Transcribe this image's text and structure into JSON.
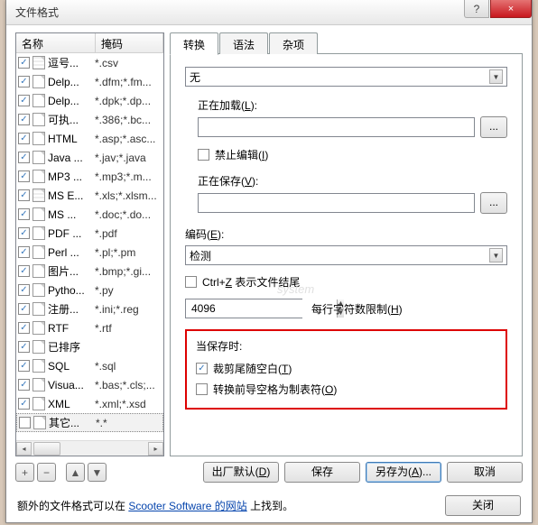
{
  "window": {
    "title": "文件格式",
    "help": "?",
    "close": "×"
  },
  "left": {
    "col_name": "名称",
    "col_mask": "掩码",
    "items": [
      {
        "chk": true,
        "icon": "grid",
        "name": "逗号...",
        "mask": "*.csv"
      },
      {
        "chk": true,
        "icon": "page",
        "name": "Delp...",
        "mask": "*.dfm;*.fm..."
      },
      {
        "chk": true,
        "icon": "page",
        "name": "Delp...",
        "mask": "*.dpk;*.dp..."
      },
      {
        "chk": true,
        "icon": "gear",
        "name": "可执...",
        "mask": "*.386;*.bc..."
      },
      {
        "chk": true,
        "icon": "page",
        "name": "HTML",
        "mask": "*.asp;*.asc..."
      },
      {
        "chk": true,
        "icon": "page",
        "name": "Java ...",
        "mask": "*.jav;*.java"
      },
      {
        "chk": true,
        "icon": "music",
        "name": "MP3 ...",
        "mask": "*.mp3;*.m..."
      },
      {
        "chk": true,
        "icon": "grid",
        "name": "MS E...",
        "mask": "*.xls;*.xlsm..."
      },
      {
        "chk": true,
        "icon": "page",
        "name": "MS ...",
        "mask": "*.doc;*.do..."
      },
      {
        "chk": true,
        "icon": "page",
        "name": "PDF ...",
        "mask": "*.pdf"
      },
      {
        "chk": true,
        "icon": "page",
        "name": "Perl ...",
        "mask": "*.pl;*.pm"
      },
      {
        "chk": true,
        "icon": "page",
        "name": "图片...",
        "mask": "*.bmp;*.gi..."
      },
      {
        "chk": true,
        "icon": "page",
        "name": "Pytho...",
        "mask": "*.py"
      },
      {
        "chk": true,
        "icon": "page",
        "name": "注册...",
        "mask": "*.ini;*.reg"
      },
      {
        "chk": true,
        "icon": "page",
        "name": "RTF",
        "mask": "*.rtf"
      },
      {
        "chk": true,
        "icon": "page",
        "name": "已排序",
        "mask": ""
      },
      {
        "chk": true,
        "icon": "page",
        "name": "SQL",
        "mask": "*.sql"
      },
      {
        "chk": true,
        "icon": "page",
        "name": "Visua...",
        "mask": "*.bas;*.cls;..."
      },
      {
        "chk": true,
        "icon": "page",
        "name": "XML",
        "mask": "*.xml;*.xsd"
      },
      {
        "chk": false,
        "icon": "page",
        "name": "其它...",
        "mask": "*.*",
        "sel": true
      }
    ]
  },
  "tabs": {
    "t1": "转换",
    "t2": "语法",
    "t3": "杂项"
  },
  "conv": {
    "none": "无",
    "loading_pre": "正在加载(",
    "loading_u": "L",
    "loading_post": "):",
    "dots": "...",
    "disable_edit_pre": "禁止编辑(",
    "disable_edit_u": "I",
    "disable_edit_post": ")",
    "saving_pre": "正在保存(",
    "saving_u": "V",
    "saving_post": "):"
  },
  "encoding": {
    "label_pre": "编码(",
    "label_u": "E",
    "label_post": "):",
    "value": "检测"
  },
  "ctrlz": {
    "pre": "Ctrl+",
    "u": "Z",
    "post": " 表示文件结尾"
  },
  "limit": {
    "value": "4096",
    "label_pre": "每行字符数限制(",
    "label_u": "H",
    "label_post": ")"
  },
  "onsave": {
    "title": "当保存时:",
    "trim_pre": "裁剪尾随空白(",
    "trim_u": "T",
    "trim_post": ")",
    "tabs_pre": "转换前导空格为制表符(",
    "tabs_u": "O",
    "tabs_post": ")"
  },
  "small_btns": {
    "add": "+",
    "del": "−",
    "up": "▲",
    "down": "▼"
  },
  "buttons": {
    "factory_pre": "出厂默认(",
    "factory_u": "D",
    "factory_post": ")",
    "save": "保存",
    "saveas_pre": "另存为(",
    "saveas_u": "A",
    "saveas_post": ")...",
    "cancel": "取消",
    "close": "关闭"
  },
  "footer": {
    "pre": "额外的文件格式可以在 ",
    "link": "Scooter Software 的网站",
    "post": " 上找到。"
  },
  "watermark": "system"
}
